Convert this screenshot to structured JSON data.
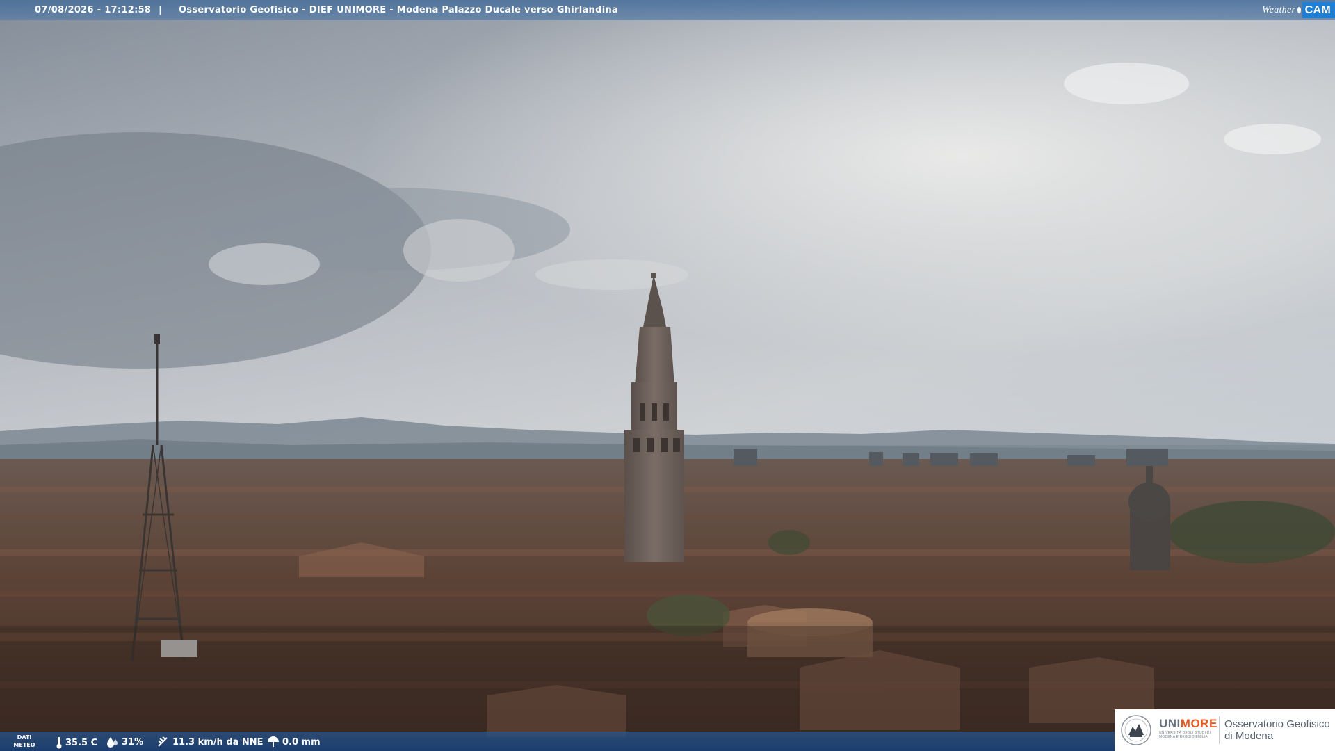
{
  "header": {
    "timestamp": "07/08/2026 - 17:12:58",
    "separator": "|",
    "location": "Osservatorio Geofisico - DIEF UNIMORE - Modena Palazzo Ducale verso Ghirlandina",
    "logo_weather": "Weather",
    "logo_cam": "CAM"
  },
  "weather": {
    "label_line1": "DATI",
    "label_line2": "METEO",
    "temperature": "35.5 C",
    "humidity": "31%",
    "wind": "11.3 km/h da NNE",
    "rain": "0.0 mm"
  },
  "branding": {
    "uni_part1": "UNI",
    "uni_part2": "MORE",
    "uni_sub": "UNIVERSITÀ DEGLI STUDI DI MODENA E REGGIO EMILIA",
    "observatory_line1": "Osservatorio Geofisico",
    "observatory_line2": "di Modena"
  },
  "colors": {
    "header_bar": "#4f76a3",
    "footer_bar": "#234f86",
    "brand_orange": "#e85a24",
    "cam_blue": "#1e7fd6"
  },
  "icons": [
    "thermometer-icon",
    "humidity-drop-icon",
    "wind-icon",
    "rain-gauge-icon"
  ]
}
